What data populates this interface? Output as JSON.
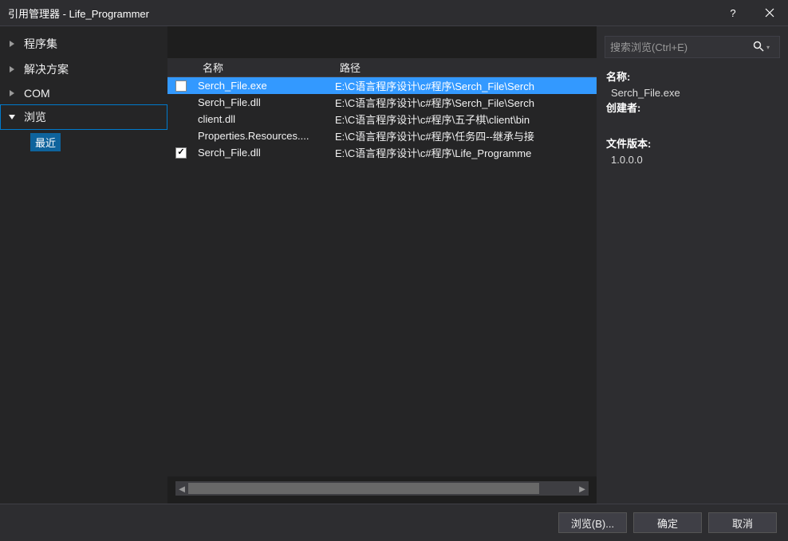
{
  "window": {
    "title": "引用管理器 - Life_Programmer",
    "help": "?",
    "close": "×"
  },
  "sidebar": {
    "items": [
      {
        "label": "程序集",
        "expanded": false
      },
      {
        "label": "解决方案",
        "expanded": false
      },
      {
        "label": "COM",
        "expanded": false
      },
      {
        "label": "浏览",
        "expanded": true
      }
    ],
    "sub_recent": "最近"
  },
  "table": {
    "headers": {
      "name": "名称",
      "path": "路径"
    },
    "rows": [
      {
        "checked": "empty",
        "selected": true,
        "name": "Serch_File.exe",
        "path": "E:\\C语言程序设计\\c#程序\\Serch_File\\Serch"
      },
      {
        "checked": "none",
        "selected": false,
        "name": "Serch_File.dll",
        "path": "E:\\C语言程序设计\\c#程序\\Serch_File\\Serch"
      },
      {
        "checked": "none",
        "selected": false,
        "name": "client.dll",
        "path": "E:\\C语言程序设计\\c#程序\\五子棋\\client\\bin"
      },
      {
        "checked": "none",
        "selected": false,
        "name": "Properties.Resources....",
        "path": "E:\\C语言程序设计\\c#程序\\任务四--继承与接"
      },
      {
        "checked": "checked",
        "selected": false,
        "name": "Serch_File.dll",
        "path": "E:\\C语言程序设计\\c#程序\\Life_Programme"
      }
    ]
  },
  "search": {
    "placeholder": "搜索浏览(Ctrl+E)"
  },
  "details": {
    "name_label": "名称:",
    "name_value": "Serch_File.exe",
    "creator_label": "创建者:",
    "creator_value": "",
    "version_label": "文件版本:",
    "version_value": "1.0.0.0"
  },
  "footer": {
    "browse": "浏览(B)...",
    "ok": "确定",
    "cancel": "取消"
  }
}
